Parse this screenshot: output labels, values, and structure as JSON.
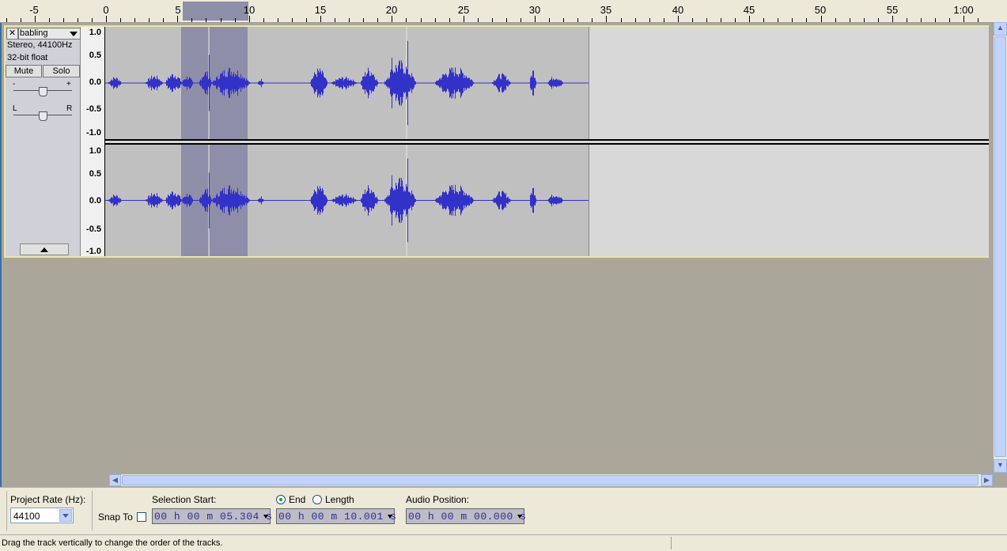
{
  "ruler": {
    "labels": [
      "-5",
      "0",
      "5",
      "10",
      "15",
      "20",
      "25",
      "30",
      "35",
      "40",
      "45",
      "50",
      "55",
      "1:00"
    ]
  },
  "track": {
    "name": "babling",
    "format": "Stereo, 44100Hz",
    "sample_format": "32-bit float",
    "mute_label": "Mute",
    "solo_label": "Solo",
    "gain_minus": "-",
    "gain_plus": "+",
    "pan_left": "L",
    "pan_right": "R",
    "close_glyph": "✕"
  },
  "amplitude_labels": [
    "1.0",
    "0.5",
    "0.0",
    "-0.5",
    "-1.0"
  ],
  "toolbar": {
    "project_rate_label": "Project Rate (Hz):",
    "project_rate_value": "44100",
    "snap_to_label": "Snap To",
    "selection_start_label": "Selection Start:",
    "end_label": "End",
    "length_label": "Length",
    "audio_position_label": "Audio Position:",
    "selection_start_value": "00 h 00 m 05.304 s",
    "selection_end_value": "00 h 00 m 10.001 s",
    "audio_position_value": "00 h 00 m 00.000 s"
  },
  "status": {
    "message": "Drag the track vertically to change the order of the tracks."
  },
  "colors": {
    "waveform": "#3232c8",
    "selection": "#8e8ea8",
    "background": "#aaa69a"
  }
}
